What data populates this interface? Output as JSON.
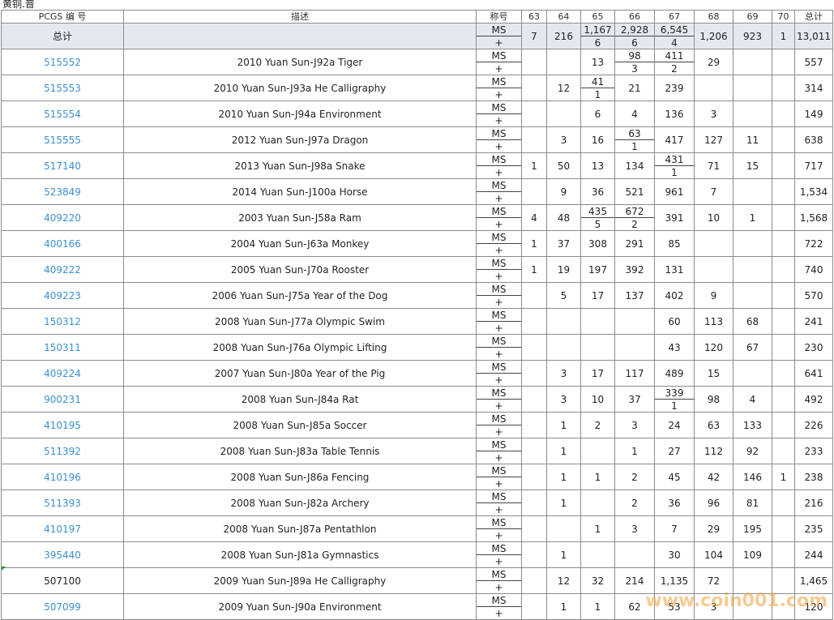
{
  "title": "黄铜.普",
  "headers": {
    "pcgs": "PCGS 编 号",
    "desc": "描述",
    "designation": "称号",
    "grades": [
      "63",
      "64",
      "65",
      "66",
      "67",
      "68",
      "69",
      "70"
    ],
    "total": "总计"
  },
  "designation_labels": {
    "top": "MS",
    "bottom": "+"
  },
  "total_row": {
    "label": "总计",
    "cells": [
      {
        "top": "7",
        "bottom": ""
      },
      {
        "top": "216",
        "bottom": ""
      },
      {
        "top": "1,167",
        "bottom": "6"
      },
      {
        "top": "2,928",
        "bottom": "6"
      },
      {
        "top": "6,545",
        "bottom": "4"
      },
      {
        "top": "1,206",
        "bottom": ""
      },
      {
        "top": "923",
        "bottom": ""
      },
      {
        "top": "1",
        "bottom": ""
      }
    ],
    "total": "13,011"
  },
  "rows": [
    {
      "pcgs": "515552",
      "link": true,
      "desc": "2010 Yuan Sun-J92a Tiger",
      "cells": [
        {
          "top": "",
          "bottom": ""
        },
        {
          "top": "",
          "bottom": ""
        },
        {
          "top": "13",
          "bottom": ""
        },
        {
          "top": "98",
          "bottom": "3"
        },
        {
          "top": "411",
          "bottom": "2"
        },
        {
          "top": "29",
          "bottom": ""
        },
        {
          "top": "",
          "bottom": ""
        },
        {
          "top": "",
          "bottom": ""
        }
      ],
      "total": "557"
    },
    {
      "pcgs": "515553",
      "link": true,
      "desc": "2010 Yuan Sun-J93a He Calligraphy",
      "cells": [
        {
          "top": "",
          "bottom": ""
        },
        {
          "top": "12",
          "bottom": ""
        },
        {
          "top": "41",
          "bottom": "1"
        },
        {
          "top": "21",
          "bottom": ""
        },
        {
          "top": "239",
          "bottom": ""
        },
        {
          "top": "",
          "bottom": ""
        },
        {
          "top": "",
          "bottom": ""
        },
        {
          "top": "",
          "bottom": ""
        }
      ],
      "total": "314"
    },
    {
      "pcgs": "515554",
      "link": true,
      "desc": "2010 Yuan Sun-J94a Environment",
      "cells": [
        {
          "top": "",
          "bottom": ""
        },
        {
          "top": "",
          "bottom": ""
        },
        {
          "top": "6",
          "bottom": ""
        },
        {
          "top": "4",
          "bottom": ""
        },
        {
          "top": "136",
          "bottom": ""
        },
        {
          "top": "3",
          "bottom": ""
        },
        {
          "top": "",
          "bottom": ""
        },
        {
          "top": "",
          "bottom": ""
        }
      ],
      "total": "149"
    },
    {
      "pcgs": "515555",
      "link": true,
      "desc": "2012 Yuan Sun-J97a Dragon",
      "cells": [
        {
          "top": "",
          "bottom": ""
        },
        {
          "top": "3",
          "bottom": ""
        },
        {
          "top": "16",
          "bottom": ""
        },
        {
          "top": "63",
          "bottom": "1"
        },
        {
          "top": "417",
          "bottom": ""
        },
        {
          "top": "127",
          "bottom": ""
        },
        {
          "top": "11",
          "bottom": ""
        },
        {
          "top": "",
          "bottom": ""
        }
      ],
      "total": "638"
    },
    {
      "pcgs": "517140",
      "link": true,
      "desc": "2013 Yuan Sun-J98a Snake",
      "cells": [
        {
          "top": "1",
          "bottom": ""
        },
        {
          "top": "50",
          "bottom": ""
        },
        {
          "top": "13",
          "bottom": ""
        },
        {
          "top": "134",
          "bottom": ""
        },
        {
          "top": "431",
          "bottom": "1"
        },
        {
          "top": "71",
          "bottom": ""
        },
        {
          "top": "15",
          "bottom": ""
        },
        {
          "top": "",
          "bottom": ""
        }
      ],
      "total": "717"
    },
    {
      "pcgs": "523849",
      "link": true,
      "desc": "2014 Yuan Sun-J100a Horse",
      "cells": [
        {
          "top": "",
          "bottom": ""
        },
        {
          "top": "9",
          "bottom": ""
        },
        {
          "top": "36",
          "bottom": ""
        },
        {
          "top": "521",
          "bottom": ""
        },
        {
          "top": "961",
          "bottom": ""
        },
        {
          "top": "7",
          "bottom": ""
        },
        {
          "top": "",
          "bottom": ""
        },
        {
          "top": "",
          "bottom": ""
        }
      ],
      "total": "1,534"
    },
    {
      "pcgs": "409220",
      "link": true,
      "desc": "2003 Yuan Sun-J58a Ram",
      "cells": [
        {
          "top": "4",
          "bottom": ""
        },
        {
          "top": "48",
          "bottom": ""
        },
        {
          "top": "435",
          "bottom": "5"
        },
        {
          "top": "672",
          "bottom": "2"
        },
        {
          "top": "391",
          "bottom": ""
        },
        {
          "top": "10",
          "bottom": ""
        },
        {
          "top": "1",
          "bottom": ""
        },
        {
          "top": "",
          "bottom": ""
        }
      ],
      "total": "1,568"
    },
    {
      "pcgs": "400166",
      "link": true,
      "desc": "2004 Yuan Sun-J63a Monkey",
      "cells": [
        {
          "top": "1",
          "bottom": ""
        },
        {
          "top": "37",
          "bottom": ""
        },
        {
          "top": "308",
          "bottom": ""
        },
        {
          "top": "291",
          "bottom": ""
        },
        {
          "top": "85",
          "bottom": ""
        },
        {
          "top": "",
          "bottom": ""
        },
        {
          "top": "",
          "bottom": ""
        },
        {
          "top": "",
          "bottom": ""
        }
      ],
      "total": "722"
    },
    {
      "pcgs": "409222",
      "link": true,
      "desc": "2005 Yuan Sun-J70a Rooster",
      "cells": [
        {
          "top": "1",
          "bottom": ""
        },
        {
          "top": "19",
          "bottom": ""
        },
        {
          "top": "197",
          "bottom": ""
        },
        {
          "top": "392",
          "bottom": ""
        },
        {
          "top": "131",
          "bottom": ""
        },
        {
          "top": "",
          "bottom": ""
        },
        {
          "top": "",
          "bottom": ""
        },
        {
          "top": "",
          "bottom": ""
        }
      ],
      "total": "740"
    },
    {
      "pcgs": "409223",
      "link": true,
      "desc": "2006 Yuan Sun-J75a Year of the Dog",
      "cells": [
        {
          "top": "",
          "bottom": ""
        },
        {
          "top": "5",
          "bottom": ""
        },
        {
          "top": "17",
          "bottom": ""
        },
        {
          "top": "137",
          "bottom": ""
        },
        {
          "top": "402",
          "bottom": ""
        },
        {
          "top": "9",
          "bottom": ""
        },
        {
          "top": "",
          "bottom": ""
        },
        {
          "top": "",
          "bottom": ""
        }
      ],
      "total": "570"
    },
    {
      "pcgs": "150312",
      "link": true,
      "desc": "2008 Yuan Sun-J77a Olympic Swim",
      "cells": [
        {
          "top": "",
          "bottom": ""
        },
        {
          "top": "",
          "bottom": ""
        },
        {
          "top": "",
          "bottom": ""
        },
        {
          "top": "",
          "bottom": ""
        },
        {
          "top": "60",
          "bottom": ""
        },
        {
          "top": "113",
          "bottom": ""
        },
        {
          "top": "68",
          "bottom": ""
        },
        {
          "top": "",
          "bottom": ""
        }
      ],
      "total": "241"
    },
    {
      "pcgs": "150311",
      "link": true,
      "desc": "2008 Yuan Sun-J76a Olympic Lifting",
      "cells": [
        {
          "top": "",
          "bottom": ""
        },
        {
          "top": "",
          "bottom": ""
        },
        {
          "top": "",
          "bottom": ""
        },
        {
          "top": "",
          "bottom": ""
        },
        {
          "top": "43",
          "bottom": ""
        },
        {
          "top": "120",
          "bottom": ""
        },
        {
          "top": "67",
          "bottom": ""
        },
        {
          "top": "",
          "bottom": ""
        }
      ],
      "total": "230"
    },
    {
      "pcgs": "409224",
      "link": true,
      "desc": "2007 Yuan Sun-J80a Year of the Pig",
      "cells": [
        {
          "top": "",
          "bottom": ""
        },
        {
          "top": "3",
          "bottom": ""
        },
        {
          "top": "17",
          "bottom": ""
        },
        {
          "top": "117",
          "bottom": ""
        },
        {
          "top": "489",
          "bottom": ""
        },
        {
          "top": "15",
          "bottom": ""
        },
        {
          "top": "",
          "bottom": ""
        },
        {
          "top": "",
          "bottom": ""
        }
      ],
      "total": "641"
    },
    {
      "pcgs": "900231",
      "link": true,
      "desc": "2008 Yuan Sun-J84a Rat",
      "cells": [
        {
          "top": "",
          "bottom": ""
        },
        {
          "top": "3",
          "bottom": ""
        },
        {
          "top": "10",
          "bottom": ""
        },
        {
          "top": "37",
          "bottom": ""
        },
        {
          "top": "339",
          "bottom": "1"
        },
        {
          "top": "98",
          "bottom": ""
        },
        {
          "top": "4",
          "bottom": ""
        },
        {
          "top": "",
          "bottom": ""
        }
      ],
      "total": "492"
    },
    {
      "pcgs": "410195",
      "link": true,
      "desc": "2008 Yuan Sun-J85a Soccer",
      "cells": [
        {
          "top": "",
          "bottom": ""
        },
        {
          "top": "1",
          "bottom": ""
        },
        {
          "top": "2",
          "bottom": ""
        },
        {
          "top": "3",
          "bottom": ""
        },
        {
          "top": "24",
          "bottom": ""
        },
        {
          "top": "63",
          "bottom": ""
        },
        {
          "top": "133",
          "bottom": ""
        },
        {
          "top": "",
          "bottom": ""
        }
      ],
      "total": "226"
    },
    {
      "pcgs": "511392",
      "link": true,
      "desc": "2008 Yuan Sun-J83a Table Tennis",
      "cells": [
        {
          "top": "",
          "bottom": ""
        },
        {
          "top": "1",
          "bottom": ""
        },
        {
          "top": "",
          "bottom": ""
        },
        {
          "top": "1",
          "bottom": ""
        },
        {
          "top": "27",
          "bottom": ""
        },
        {
          "top": "112",
          "bottom": ""
        },
        {
          "top": "92",
          "bottom": ""
        },
        {
          "top": "",
          "bottom": ""
        }
      ],
      "total": "233"
    },
    {
      "pcgs": "410196",
      "link": true,
      "desc": "2008 Yuan Sun-J86a Fencing",
      "cells": [
        {
          "top": "",
          "bottom": ""
        },
        {
          "top": "1",
          "bottom": ""
        },
        {
          "top": "1",
          "bottom": ""
        },
        {
          "top": "2",
          "bottom": ""
        },
        {
          "top": "45",
          "bottom": ""
        },
        {
          "top": "42",
          "bottom": ""
        },
        {
          "top": "146",
          "bottom": ""
        },
        {
          "top": "1",
          "bottom": ""
        }
      ],
      "total": "238"
    },
    {
      "pcgs": "511393",
      "link": true,
      "desc": "2008 Yuan Sun-J82a Archery",
      "cells": [
        {
          "top": "",
          "bottom": ""
        },
        {
          "top": "1",
          "bottom": ""
        },
        {
          "top": "",
          "bottom": ""
        },
        {
          "top": "2",
          "bottom": ""
        },
        {
          "top": "36",
          "bottom": ""
        },
        {
          "top": "96",
          "bottom": ""
        },
        {
          "top": "81",
          "bottom": ""
        },
        {
          "top": "",
          "bottom": ""
        }
      ],
      "total": "216"
    },
    {
      "pcgs": "410197",
      "link": true,
      "desc": "2008 Yuan Sun-J87a Pentathlon",
      "cells": [
        {
          "top": "",
          "bottom": ""
        },
        {
          "top": "",
          "bottom": ""
        },
        {
          "top": "1",
          "bottom": ""
        },
        {
          "top": "3",
          "bottom": ""
        },
        {
          "top": "7",
          "bottom": ""
        },
        {
          "top": "29",
          "bottom": ""
        },
        {
          "top": "195",
          "bottom": ""
        },
        {
          "top": "",
          "bottom": ""
        }
      ],
      "total": "235"
    },
    {
      "pcgs": "395440",
      "link": true,
      "desc": "2008 Yuan Sun-J81a Gymnastics",
      "cells": [
        {
          "top": "",
          "bottom": ""
        },
        {
          "top": "1",
          "bottom": ""
        },
        {
          "top": "",
          "bottom": ""
        },
        {
          "top": "",
          "bottom": ""
        },
        {
          "top": "30",
          "bottom": ""
        },
        {
          "top": "104",
          "bottom": ""
        },
        {
          "top": "109",
          "bottom": ""
        },
        {
          "top": "",
          "bottom": ""
        }
      ],
      "total": "244"
    },
    {
      "pcgs": "507100",
      "link": false,
      "desc": "2009 Yuan Sun-J89a He Calligraphy",
      "cells": [
        {
          "top": "",
          "bottom": ""
        },
        {
          "top": "12",
          "bottom": ""
        },
        {
          "top": "32",
          "bottom": ""
        },
        {
          "top": "214",
          "bottom": ""
        },
        {
          "top": "1,135",
          "bottom": ""
        },
        {
          "top": "72",
          "bottom": ""
        },
        {
          "top": "",
          "bottom": ""
        },
        {
          "top": "",
          "bottom": ""
        }
      ],
      "total": "1,465"
    },
    {
      "pcgs": "507099",
      "link": true,
      "desc": "2009 Yuan Sun-J90a Environment",
      "cells": [
        {
          "top": "",
          "bottom": ""
        },
        {
          "top": "1",
          "bottom": ""
        },
        {
          "top": "1",
          "bottom": ""
        },
        {
          "top": "62",
          "bottom": ""
        },
        {
          "top": "53",
          "bottom": ""
        },
        {
          "top": "3",
          "bottom": ""
        },
        {
          "top": "",
          "bottom": ""
        },
        {
          "top": "",
          "bottom": ""
        }
      ],
      "total": "120"
    }
  ],
  "watermark": "www.coin001.com"
}
